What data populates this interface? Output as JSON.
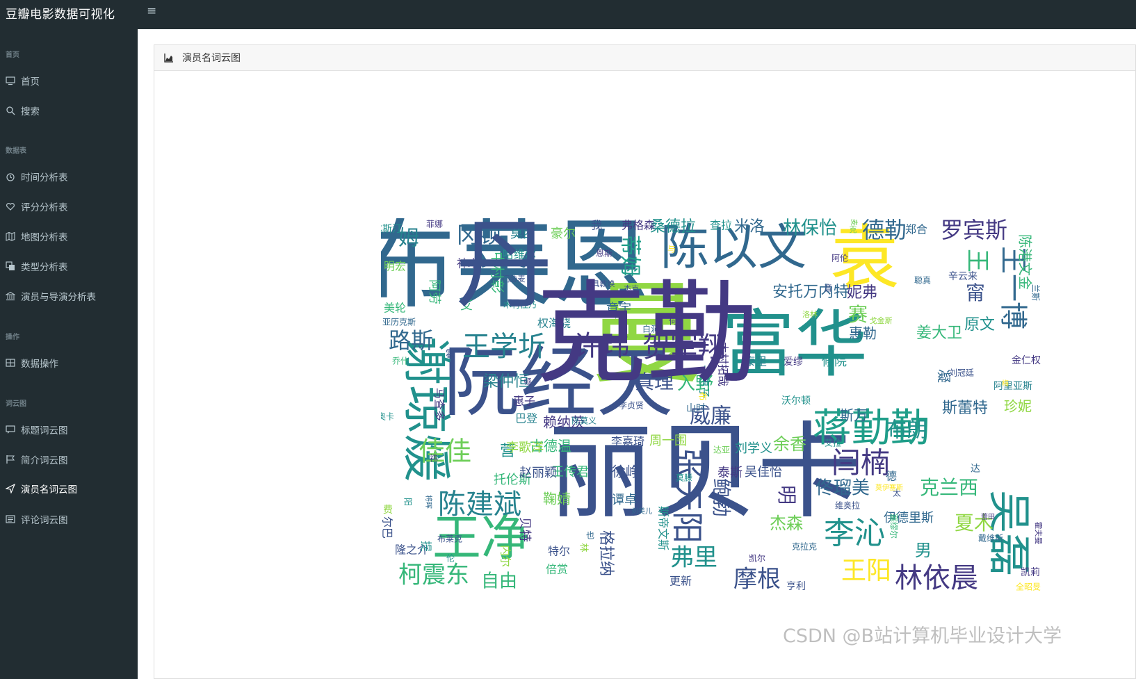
{
  "app": {
    "title": "豆瓣电影数据可视化",
    "menu_toggle_icon": "hamburger-icon"
  },
  "sidebar": {
    "sections": [
      {
        "header": "首页",
        "items": [
          {
            "label": "首页",
            "icon": "monitor-icon"
          },
          {
            "label": "搜索",
            "icon": "search-icon"
          }
        ]
      },
      {
        "header": "数据表",
        "items": [
          {
            "label": "时间分析表",
            "icon": "clock-icon"
          },
          {
            "label": "评分分析表",
            "icon": "heart-icon"
          },
          {
            "label": "地图分析表",
            "icon": "map-icon"
          },
          {
            "label": "类型分析表",
            "icon": "copy-icon"
          },
          {
            "label": "演员与导演分析表",
            "icon": "bank-icon"
          }
        ]
      },
      {
        "header": "操作",
        "items": [
          {
            "label": "数据操作",
            "icon": "table-icon"
          }
        ]
      },
      {
        "header": "词云图",
        "items": [
          {
            "label": "标题词云图",
            "icon": "comment-icon"
          },
          {
            "label": "简介词云图",
            "icon": "flag-icon"
          },
          {
            "label": "演员名词云图",
            "icon": "send-icon",
            "active": true
          },
          {
            "label": "评论词云图",
            "icon": "list-icon"
          }
        ]
      }
    ]
  },
  "panel": {
    "title": "演员名词云图",
    "icon": "area-chart-icon"
  },
  "wordcloud": {
    "palette": [
      "#31688e",
      "#3b528b",
      "#21918c",
      "#35b779",
      "#90d743",
      "#fde725",
      "#443983",
      "#26828e",
      "#1f9e89",
      "#6ece58"
    ],
    "words": [
      {
        "text": "布莱恩",
        "color": "#31688e"
      },
      {
        "text": "曼",
        "color": "#90d743"
      },
      {
        "text": "丽贝卡",
        "color": "#3b528b"
      },
      {
        "text": "袁",
        "color": "#fde725"
      },
      {
        "text": "富华",
        "color": "#21918c"
      },
      {
        "text": "阮经天",
        "color": "#3b528b"
      },
      {
        "text": "陈以文",
        "color": "#31688e"
      },
      {
        "text": "谢琼煖",
        "color": "#21918c"
      },
      {
        "text": "王净",
        "color": "#35b779"
      },
      {
        "text": "许玮",
        "color": "#443983"
      },
      {
        "text": "贺军翔",
        "color": "#443983"
      },
      {
        "text": "王学圻",
        "color": "#26828e"
      },
      {
        "text": "蒋勤勤",
        "color": "#1f9e89"
      },
      {
        "text": "吴磊",
        "color": "#21918c"
      },
      {
        "text": "王一博",
        "color": "#31688e"
      },
      {
        "text": "陈建斌",
        "color": "#26828e"
      },
      {
        "text": "张天阳",
        "color": "#3b528b"
      },
      {
        "text": "李沁",
        "color": "#21918c"
      },
      {
        "text": "林依晨",
        "color": "#443983"
      },
      {
        "text": "柯震东",
        "color": "#35b779"
      },
      {
        "text": "闫楠",
        "color": "#443983"
      },
      {
        "text": "佳佳",
        "color": "#6ece58"
      },
      {
        "text": "路斯",
        "color": "#31688e"
      },
      {
        "text": "罗宾斯",
        "color": "#443983"
      },
      {
        "text": "德勒",
        "color": "#31688e"
      },
      {
        "text": "王阳",
        "color": "#fde725"
      },
      {
        "text": "冈顿",
        "color": "#31688e"
      },
      {
        "text": "姆",
        "color": "#26828e"
      },
      {
        "text": "蒂姆",
        "color": "#1f9e89"
      },
      {
        "text": "王",
        "color": "#35b779"
      },
      {
        "text": "林保怡",
        "color": "#21918c"
      },
      {
        "text": "桑德拉",
        "color": "#21918c"
      },
      {
        "text": "米洛",
        "color": "#31688e"
      },
      {
        "text": "真理",
        "color": "#3b528b"
      },
      {
        "text": "入野",
        "color": "#35b779"
      },
      {
        "text": "威廉",
        "color": "#3b528b"
      },
      {
        "text": "布朗",
        "color": "#21918c"
      },
      {
        "text": "摩根",
        "color": "#3b528b"
      },
      {
        "text": "弗里",
        "color": "#21918c"
      },
      {
        "text": "鲍勃",
        "color": "#3b528b"
      },
      {
        "text": "佟瑠美",
        "color": "#31688e"
      },
      {
        "text": "克兰西",
        "color": "#35b779"
      },
      {
        "text": "夏木",
        "color": "#90d743"
      },
      {
        "text": "自由",
        "color": "#35b779"
      },
      {
        "text": "杰森",
        "color": "#6ece58"
      },
      {
        "text": "余香",
        "color": "#6ece58"
      },
      {
        "text": "安托万内特",
        "color": "#31688e"
      },
      {
        "text": "妮弗",
        "color": "#443983"
      },
      {
        "text": "梁仲恒",
        "color": "#26828e"
      },
      {
        "text": "赖纳茨",
        "color": "#443983"
      },
      {
        "text": "古德温",
        "color": "#35b779"
      },
      {
        "text": "斯蕾特",
        "color": "#31688e"
      },
      {
        "text": "惠勒",
        "color": "#31688e"
      },
      {
        "text": "姜大卫",
        "color": "#35b779"
      },
      {
        "text": "原文",
        "color": "#21918c"
      },
      {
        "text": "赛",
        "color": "#6ece58"
      },
      {
        "text": "甯",
        "color": "#3b528b"
      },
      {
        "text": "陈港文金",
        "color": "#35b779"
      },
      {
        "text": "托伦斯",
        "color": "#35b779"
      },
      {
        "text": "营",
        "color": "#21918c"
      },
      {
        "text": "明",
        "color": "#443983"
      },
      {
        "text": "伊德里斯",
        "color": "#31688e"
      },
      {
        "text": "男",
        "color": "#21918c"
      },
      {
        "text": "珍妮",
        "color": "#90d743"
      },
      {
        "text": "凝",
        "color": "#31688e"
      },
      {
        "text": "斯万",
        "color": "#31688e"
      },
      {
        "text": "徐峥",
        "color": "#3b528b"
      },
      {
        "text": "章宇",
        "color": "#31688e"
      },
      {
        "text": "中村彰",
        "color": "#35b779"
      },
      {
        "text": "周一围",
        "color": "#90d743"
      },
      {
        "text": "李歌洋",
        "color": "#90d743"
      },
      {
        "text": "刘学义",
        "color": "#21918c"
      },
      {
        "text": "格拉纳",
        "color": "#3b528b"
      },
      {
        "text": "谭卓",
        "color": "#31688e"
      },
      {
        "text": "泰斯",
        "color": "#443983"
      },
      {
        "text": "王传君",
        "color": "#35b779"
      },
      {
        "text": "赵丽颖",
        "color": "#3b528b"
      },
      {
        "text": "吴佳怡",
        "color": "#3b528b"
      },
      {
        "text": "鞠婧",
        "color": "#6ece58"
      },
      {
        "text": "李嘉琦",
        "color": "#3b528b"
      },
      {
        "text": "惠子",
        "color": "#443983"
      },
      {
        "text": "巴登",
        "color": "#26828e"
      },
      {
        "text": "莫西",
        "color": "#26828e"
      },
      {
        "text": "豪尔",
        "color": "#6ece58"
      },
      {
        "text": "哈维尔",
        "color": "#21918c"
      },
      {
        "text": "神木",
        "color": "#443983"
      },
      {
        "text": "艾",
        "color": "#35b779"
      },
      {
        "text": "阿劳",
        "color": "#35b779"
      },
      {
        "text": "美轮",
        "color": "#35b779"
      },
      {
        "text": "明宏",
        "color": "#6ece58"
      },
      {
        "text": "查拉",
        "color": "#21918c"
      },
      {
        "text": "我",
        "color": "#3b528b"
      },
      {
        "text": "弗格森",
        "color": "#443983"
      },
      {
        "text": "郑合",
        "color": "#31688e"
      },
      {
        "text": "辛云来",
        "color": "#3b528b"
      },
      {
        "text": "金仁权",
        "color": "#443983"
      },
      {
        "text": "阿里亚斯",
        "color": "#26828e"
      },
      {
        "text": "修院",
        "color": "#21918c"
      },
      {
        "text": "泰里",
        "color": "#26828e"
      },
      {
        "text": "爱缪",
        "color": "#443983"
      },
      {
        "text": "沃尔顿",
        "color": "#21918c"
      },
      {
        "text": "木村拓哉",
        "color": "#443983"
      },
      {
        "text": "千惠子",
        "color": "#21918c"
      },
      {
        "text": "李贞贤",
        "color": "#3b528b"
      },
      {
        "text": "山时",
        "color": "#31688e"
      },
      {
        "text": "亨利",
        "color": "#3b528b"
      },
      {
        "text": "凯尔",
        "color": "#443983"
      },
      {
        "text": "克拉克",
        "color": "#31688e"
      },
      {
        "text": "戴维斯",
        "color": "#31688e"
      },
      {
        "text": "凯莉",
        "color": "#443983"
      },
      {
        "text": "倍赏",
        "color": "#35b779"
      },
      {
        "text": "特尔",
        "color": "#3b528b"
      },
      {
        "text": "贝特",
        "color": "#443983"
      },
      {
        "text": "隆之介",
        "color": "#3b528b"
      },
      {
        "text": "提",
        "color": "#21918c"
      },
      {
        "text": "布莱克",
        "color": "#3b528b"
      },
      {
        "text": "尔巴",
        "color": "#3b528b"
      },
      {
        "text": "达",
        "color": "#31688e"
      },
      {
        "text": "德",
        "color": "#31688e"
      },
      {
        "text": "维奥拉",
        "color": "#3b528b"
      },
      {
        "text": "马查多",
        "color": "#443983"
      },
      {
        "text": "乔什",
        "color": "#35b779"
      },
      {
        "text": "亚历克斯",
        "color": "#31688e"
      },
      {
        "text": "权海骁",
        "color": "#26828e"
      },
      {
        "text": "赞",
        "color": "#6ece58"
      },
      {
        "text": "何",
        "color": "#443983"
      },
      {
        "text": "菲娜",
        "color": "#443983"
      },
      {
        "text": "达斯汀",
        "color": "#21918c"
      },
      {
        "text": "与",
        "color": "#fde725"
      },
      {
        "text": "恩斯",
        "color": "#443983"
      },
      {
        "text": "阿伦",
        "color": "#443983"
      },
      {
        "text": "聪真",
        "color": "#31688e"
      },
      {
        "text": "兰斯",
        "color": "#31688e"
      },
      {
        "text": "戈金斯",
        "color": "#90d743"
      },
      {
        "text": "洛林",
        "color": "#90d743"
      },
      {
        "text": "杰克",
        "color": "#3b528b"
      },
      {
        "text": "木村佳乃",
        "color": "#21918c"
      },
      {
        "text": "门胁麦",
        "color": "#3b528b"
      },
      {
        "text": "具教焕",
        "color": "#3b528b"
      },
      {
        "text": "白洞",
        "color": "#31688e"
      },
      {
        "text": "内尔",
        "color": "#90d743"
      },
      {
        "text": "林",
        "color": "#90d743"
      },
      {
        "text": "也",
        "color": "#31688e"
      },
      {
        "text": "斯帝文斯",
        "color": "#21918c"
      },
      {
        "text": "更新",
        "color": "#3b528b"
      },
      {
        "text": "塞缪尔",
        "color": "#35b779"
      },
      {
        "text": "太",
        "color": "#3b528b"
      },
      {
        "text": "达亚",
        "color": "#6ece58"
      },
      {
        "text": "艾拉",
        "color": "#21918c"
      },
      {
        "text": "莫滕",
        "color": "#21918c"
      },
      {
        "text": "费",
        "color": "#90d743"
      },
      {
        "text": "伦",
        "color": "#21918c"
      },
      {
        "text": "祎",
        "color": "#443983"
      },
      {
        "text": "将晖",
        "color": "#31688e"
      },
      {
        "text": "阳",
        "color": "#21918c"
      },
      {
        "text": "霍夫曼",
        "color": "#443983"
      },
      {
        "text": "蕾田",
        "color": "#443983"
      },
      {
        "text": "莫伊塞斯",
        "color": "#fde725"
      },
      {
        "text": "刘美儿",
        "color": "#31688e"
      },
      {
        "text": "全昭旻",
        "color": "#fde725"
      },
      {
        "text": "刘冠廷",
        "color": "#3b528b"
      },
      {
        "text": "梅",
        "color": "#fde725"
      },
      {
        "text": "霍",
        "color": "#3b528b"
      },
      {
        "text": "顿",
        "color": "#443983"
      },
      {
        "text": "奥卡",
        "color": "#21918c"
      },
      {
        "text": "陈莫义",
        "color": "#26828e"
      },
      {
        "text": "音",
        "color": "#3b528b"
      },
      {
        "text": "克",
        "color": "#6ece58"
      },
      {
        "text": "布",
        "color": "#fde725"
      },
      {
        "text": "麦",
        "color": "#6ece58"
      },
      {
        "text": "丹",
        "color": "#3b528b"
      },
      {
        "text": "克勤",
        "color": "#443983"
      }
    ]
  },
  "watermark": "CSDN @B站计算机毕业设计大学"
}
